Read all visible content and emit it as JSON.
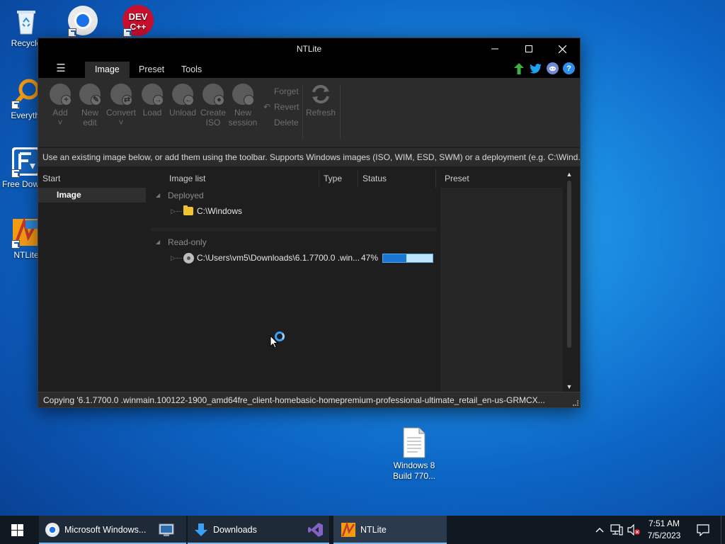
{
  "desktop": {
    "icons": [
      {
        "label": "Recycle"
      },
      {
        "label": ""
      },
      {
        "label": "DEV C++"
      },
      {
        "label": "Everythi"
      },
      {
        "label": "Free Downlo"
      },
      {
        "label": "NTLite"
      },
      {
        "label": "Windows 8 Build 770..."
      }
    ]
  },
  "window": {
    "title": "NTLite",
    "menu_icon": "hamburger-icon",
    "tabs": [
      {
        "label": "Image",
        "active": true
      },
      {
        "label": "Preset",
        "active": false
      },
      {
        "label": "Tools",
        "active": false
      }
    ],
    "header_icons": [
      "update-arrow-icon",
      "twitter-icon",
      "discord-icon",
      "help-icon"
    ],
    "toolbar": {
      "add": {
        "line1": "Add",
        "line2": "˅"
      },
      "new_edit": {
        "line1": "New",
        "line2": "edit"
      },
      "convert": {
        "line1": "Convert",
        "line2": "˅"
      },
      "load": {
        "line1": "Load"
      },
      "unload": {
        "line1": "Unload"
      },
      "create_iso": {
        "line1": "Create",
        "line2": "ISO"
      },
      "new_session": {
        "line1": "New",
        "line2": "session"
      },
      "forget": "Forget",
      "revert": "Revert",
      "delete": "Delete",
      "refresh": "Refresh"
    },
    "info_text": "Use an existing image below, or add them using the toolbar. Supports Windows images (ISO, WIM, ESD, SWM) or a deployment (e.g. C:\\Wind...",
    "start": {
      "header": "Start",
      "item": "Image"
    },
    "image_list": {
      "columns": {
        "name": "Image list",
        "type": "Type",
        "status": "Status"
      },
      "groups": [
        {
          "label": "Deployed",
          "rows": [
            {
              "name": "C:\\Windows",
              "icon": "folder-icon"
            }
          ]
        },
        {
          "label": "Read-only",
          "rows": [
            {
              "name": "C:\\Users\\vm5\\Downloads\\6.1.7700.0 .win...",
              "icon": "disc-icon",
              "status_percent_text": "47%",
              "progress": 0.47
            }
          ]
        }
      ]
    },
    "preset": {
      "header": "Preset"
    },
    "status_text": "Copying '6.1.7700.0 .winmain.100122-1900_amd64fre_client-homebasic-homepremium-professional-ultimate_retail_en-us-GRMCX..."
  },
  "taskbar": {
    "items": [
      {
        "label": "Microsoft Windows..."
      },
      {
        "label": ""
      },
      {
        "label": "Downloads"
      },
      {
        "label": ""
      },
      {
        "label": "NTLite"
      }
    ],
    "clock": {
      "time": "7:51 AM",
      "date": "7/5/2023"
    }
  },
  "colors": {
    "accent": "#1976d2",
    "window_bg": "#1e1e1e",
    "titlebar": "#000000",
    "taskbar": "#101822"
  }
}
